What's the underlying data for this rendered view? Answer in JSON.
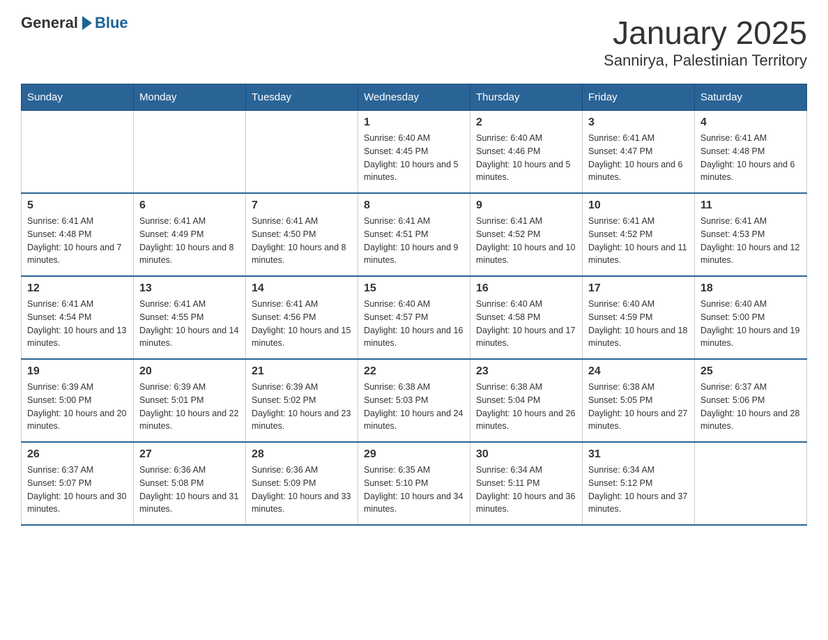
{
  "logo": {
    "text_general": "General",
    "text_blue": "Blue"
  },
  "title": "January 2025",
  "subtitle": "Sannirya, Palestinian Territory",
  "days_of_week": [
    "Sunday",
    "Monday",
    "Tuesday",
    "Wednesday",
    "Thursday",
    "Friday",
    "Saturday"
  ],
  "weeks": [
    [
      {
        "day": "",
        "info": ""
      },
      {
        "day": "",
        "info": ""
      },
      {
        "day": "",
        "info": ""
      },
      {
        "day": "1",
        "info": "Sunrise: 6:40 AM\nSunset: 4:45 PM\nDaylight: 10 hours and 5 minutes."
      },
      {
        "day": "2",
        "info": "Sunrise: 6:40 AM\nSunset: 4:46 PM\nDaylight: 10 hours and 5 minutes."
      },
      {
        "day": "3",
        "info": "Sunrise: 6:41 AM\nSunset: 4:47 PM\nDaylight: 10 hours and 6 minutes."
      },
      {
        "day": "4",
        "info": "Sunrise: 6:41 AM\nSunset: 4:48 PM\nDaylight: 10 hours and 6 minutes."
      }
    ],
    [
      {
        "day": "5",
        "info": "Sunrise: 6:41 AM\nSunset: 4:48 PM\nDaylight: 10 hours and 7 minutes."
      },
      {
        "day": "6",
        "info": "Sunrise: 6:41 AM\nSunset: 4:49 PM\nDaylight: 10 hours and 8 minutes."
      },
      {
        "day": "7",
        "info": "Sunrise: 6:41 AM\nSunset: 4:50 PM\nDaylight: 10 hours and 8 minutes."
      },
      {
        "day": "8",
        "info": "Sunrise: 6:41 AM\nSunset: 4:51 PM\nDaylight: 10 hours and 9 minutes."
      },
      {
        "day": "9",
        "info": "Sunrise: 6:41 AM\nSunset: 4:52 PM\nDaylight: 10 hours and 10 minutes."
      },
      {
        "day": "10",
        "info": "Sunrise: 6:41 AM\nSunset: 4:52 PM\nDaylight: 10 hours and 11 minutes."
      },
      {
        "day": "11",
        "info": "Sunrise: 6:41 AM\nSunset: 4:53 PM\nDaylight: 10 hours and 12 minutes."
      }
    ],
    [
      {
        "day": "12",
        "info": "Sunrise: 6:41 AM\nSunset: 4:54 PM\nDaylight: 10 hours and 13 minutes."
      },
      {
        "day": "13",
        "info": "Sunrise: 6:41 AM\nSunset: 4:55 PM\nDaylight: 10 hours and 14 minutes."
      },
      {
        "day": "14",
        "info": "Sunrise: 6:41 AM\nSunset: 4:56 PM\nDaylight: 10 hours and 15 minutes."
      },
      {
        "day": "15",
        "info": "Sunrise: 6:40 AM\nSunset: 4:57 PM\nDaylight: 10 hours and 16 minutes."
      },
      {
        "day": "16",
        "info": "Sunrise: 6:40 AM\nSunset: 4:58 PM\nDaylight: 10 hours and 17 minutes."
      },
      {
        "day": "17",
        "info": "Sunrise: 6:40 AM\nSunset: 4:59 PM\nDaylight: 10 hours and 18 minutes."
      },
      {
        "day": "18",
        "info": "Sunrise: 6:40 AM\nSunset: 5:00 PM\nDaylight: 10 hours and 19 minutes."
      }
    ],
    [
      {
        "day": "19",
        "info": "Sunrise: 6:39 AM\nSunset: 5:00 PM\nDaylight: 10 hours and 20 minutes."
      },
      {
        "day": "20",
        "info": "Sunrise: 6:39 AM\nSunset: 5:01 PM\nDaylight: 10 hours and 22 minutes."
      },
      {
        "day": "21",
        "info": "Sunrise: 6:39 AM\nSunset: 5:02 PM\nDaylight: 10 hours and 23 minutes."
      },
      {
        "day": "22",
        "info": "Sunrise: 6:38 AM\nSunset: 5:03 PM\nDaylight: 10 hours and 24 minutes."
      },
      {
        "day": "23",
        "info": "Sunrise: 6:38 AM\nSunset: 5:04 PM\nDaylight: 10 hours and 26 minutes."
      },
      {
        "day": "24",
        "info": "Sunrise: 6:38 AM\nSunset: 5:05 PM\nDaylight: 10 hours and 27 minutes."
      },
      {
        "day": "25",
        "info": "Sunrise: 6:37 AM\nSunset: 5:06 PM\nDaylight: 10 hours and 28 minutes."
      }
    ],
    [
      {
        "day": "26",
        "info": "Sunrise: 6:37 AM\nSunset: 5:07 PM\nDaylight: 10 hours and 30 minutes."
      },
      {
        "day": "27",
        "info": "Sunrise: 6:36 AM\nSunset: 5:08 PM\nDaylight: 10 hours and 31 minutes."
      },
      {
        "day": "28",
        "info": "Sunrise: 6:36 AM\nSunset: 5:09 PM\nDaylight: 10 hours and 33 minutes."
      },
      {
        "day": "29",
        "info": "Sunrise: 6:35 AM\nSunset: 5:10 PM\nDaylight: 10 hours and 34 minutes."
      },
      {
        "day": "30",
        "info": "Sunrise: 6:34 AM\nSunset: 5:11 PM\nDaylight: 10 hours and 36 minutes."
      },
      {
        "day": "31",
        "info": "Sunrise: 6:34 AM\nSunset: 5:12 PM\nDaylight: 10 hours and 37 minutes."
      },
      {
        "day": "",
        "info": ""
      }
    ]
  ]
}
